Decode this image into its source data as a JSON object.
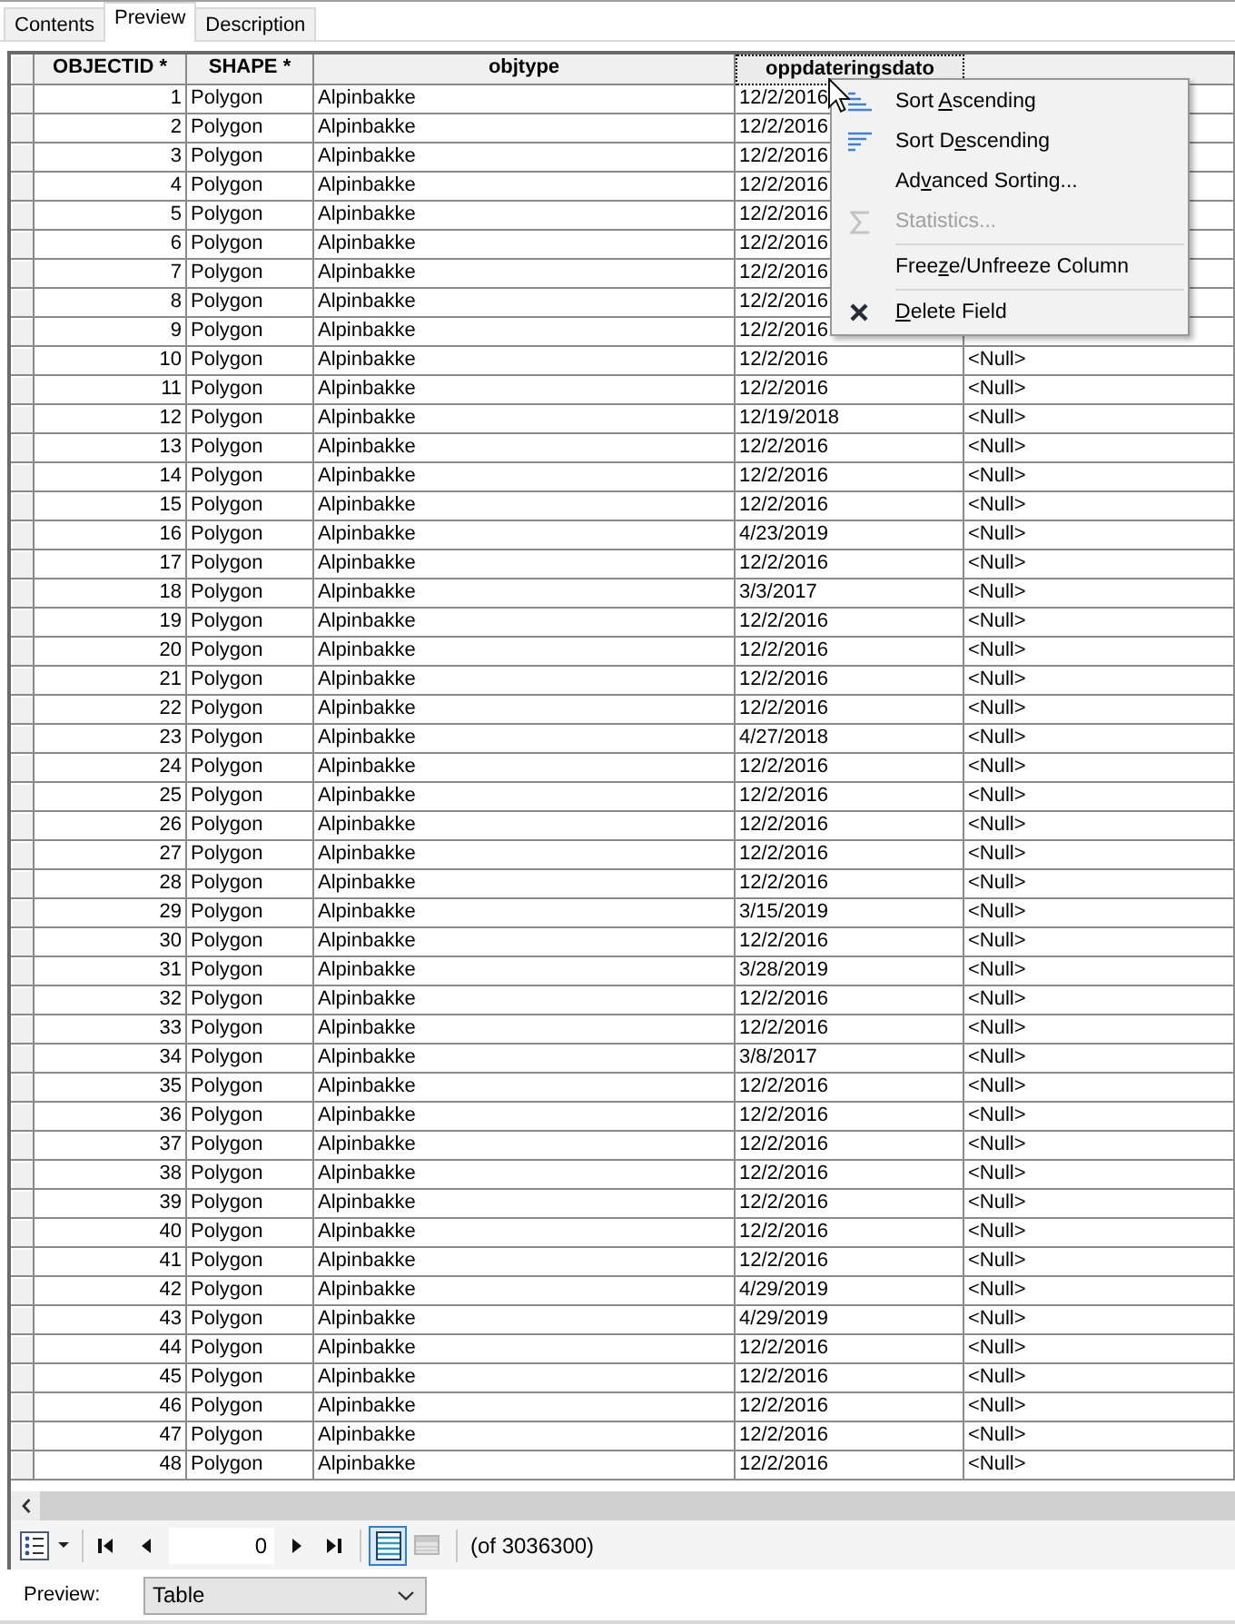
{
  "tabs": [
    {
      "label": "Contents",
      "selected": false
    },
    {
      "label": "Preview",
      "selected": true
    },
    {
      "label": "Description",
      "selected": false
    }
  ],
  "table": {
    "columns": [
      {
        "label": "OBJECTID *",
        "selected": false
      },
      {
        "label": "SHAPE *",
        "selected": false
      },
      {
        "label": "objtype",
        "selected": false
      },
      {
        "label": "oppdateringsdato",
        "selected": true
      },
      {
        "selected": false
      }
    ],
    "rows": [
      {
        "cells": [
          "1",
          "Polygon",
          "Alpinbakke",
          "12/2/2016"
        ]
      },
      {
        "cells": [
          "2",
          "Polygon",
          "Alpinbakke",
          "12/2/2016"
        ]
      },
      {
        "cells": [
          "3",
          "Polygon",
          "Alpinbakke",
          "12/2/2016"
        ]
      },
      {
        "cells": [
          "4",
          "Polygon",
          "Alpinbakke",
          "12/2/2016"
        ]
      },
      {
        "cells": [
          "5",
          "Polygon",
          "Alpinbakke",
          "12/2/2016"
        ]
      },
      {
        "cells": [
          "6",
          "Polygon",
          "Alpinbakke",
          "12/2/2016"
        ]
      },
      {
        "cells": [
          "7",
          "Polygon",
          "Alpinbakke",
          "12/2/2016"
        ]
      },
      {
        "cells": [
          "8",
          "Polygon",
          "Alpinbakke",
          "12/2/2016"
        ]
      },
      {
        "cells": [
          "9",
          "Polygon",
          "Alpinbakke",
          "12/2/2016"
        ]
      },
      {
        "cells": [
          "10",
          "Polygon",
          "Alpinbakke",
          "12/2/2016",
          "<Null>"
        ]
      },
      {
        "cells": [
          "11",
          "Polygon",
          "Alpinbakke",
          "12/2/2016",
          "<Null>"
        ]
      },
      {
        "cells": [
          "12",
          "Polygon",
          "Alpinbakke",
          "12/19/2018",
          "<Null>"
        ]
      },
      {
        "cells": [
          "13",
          "Polygon",
          "Alpinbakke",
          "12/2/2016",
          "<Null>"
        ]
      },
      {
        "cells": [
          "14",
          "Polygon",
          "Alpinbakke",
          "12/2/2016",
          "<Null>"
        ]
      },
      {
        "cells": [
          "15",
          "Polygon",
          "Alpinbakke",
          "12/2/2016",
          "<Null>"
        ]
      },
      {
        "cells": [
          "16",
          "Polygon",
          "Alpinbakke",
          "4/23/2019",
          "<Null>"
        ]
      },
      {
        "cells": [
          "17",
          "Polygon",
          "Alpinbakke",
          "12/2/2016",
          "<Null>"
        ]
      },
      {
        "cells": [
          "18",
          "Polygon",
          "Alpinbakke",
          "3/3/2017",
          "<Null>"
        ]
      },
      {
        "cells": [
          "19",
          "Polygon",
          "Alpinbakke",
          "12/2/2016",
          "<Null>"
        ]
      },
      {
        "cells": [
          "20",
          "Polygon",
          "Alpinbakke",
          "12/2/2016",
          "<Null>"
        ]
      },
      {
        "cells": [
          "21",
          "Polygon",
          "Alpinbakke",
          "12/2/2016",
          "<Null>"
        ]
      },
      {
        "cells": [
          "22",
          "Polygon",
          "Alpinbakke",
          "12/2/2016",
          "<Null>"
        ]
      },
      {
        "cells": [
          "23",
          "Polygon",
          "Alpinbakke",
          "4/27/2018",
          "<Null>"
        ]
      },
      {
        "cells": [
          "24",
          "Polygon",
          "Alpinbakke",
          "12/2/2016",
          "<Null>"
        ]
      },
      {
        "cells": [
          "25",
          "Polygon",
          "Alpinbakke",
          "12/2/2016",
          "<Null>"
        ]
      },
      {
        "cells": [
          "26",
          "Polygon",
          "Alpinbakke",
          "12/2/2016",
          "<Null>"
        ]
      },
      {
        "cells": [
          "27",
          "Polygon",
          "Alpinbakke",
          "12/2/2016",
          "<Null>"
        ]
      },
      {
        "cells": [
          "28",
          "Polygon",
          "Alpinbakke",
          "12/2/2016",
          "<Null>"
        ]
      },
      {
        "cells": [
          "29",
          "Polygon",
          "Alpinbakke",
          "3/15/2019",
          "<Null>"
        ]
      },
      {
        "cells": [
          "30",
          "Polygon",
          "Alpinbakke",
          "12/2/2016",
          "<Null>"
        ]
      },
      {
        "cells": [
          "31",
          "Polygon",
          "Alpinbakke",
          "3/28/2019",
          "<Null>"
        ]
      },
      {
        "cells": [
          "32",
          "Polygon",
          "Alpinbakke",
          "12/2/2016",
          "<Null>"
        ]
      },
      {
        "cells": [
          "33",
          "Polygon",
          "Alpinbakke",
          "12/2/2016",
          "<Null>"
        ]
      },
      {
        "cells": [
          "34",
          "Polygon",
          "Alpinbakke",
          "3/8/2017",
          "<Null>"
        ]
      },
      {
        "cells": [
          "35",
          "Polygon",
          "Alpinbakke",
          "12/2/2016",
          "<Null>"
        ]
      },
      {
        "cells": [
          "36",
          "Polygon",
          "Alpinbakke",
          "12/2/2016",
          "<Null>"
        ]
      },
      {
        "cells": [
          "37",
          "Polygon",
          "Alpinbakke",
          "12/2/2016",
          "<Null>"
        ]
      },
      {
        "cells": [
          "38",
          "Polygon",
          "Alpinbakke",
          "12/2/2016",
          "<Null>"
        ]
      },
      {
        "cells": [
          "39",
          "Polygon",
          "Alpinbakke",
          "12/2/2016",
          "<Null>"
        ]
      },
      {
        "cells": [
          "40",
          "Polygon",
          "Alpinbakke",
          "12/2/2016",
          "<Null>"
        ]
      },
      {
        "cells": [
          "41",
          "Polygon",
          "Alpinbakke",
          "12/2/2016",
          "<Null>"
        ]
      },
      {
        "cells": [
          "42",
          "Polygon",
          "Alpinbakke",
          "4/29/2019",
          "<Null>"
        ]
      },
      {
        "cells": [
          "43",
          "Polygon",
          "Alpinbakke",
          "4/29/2019",
          "<Null>"
        ]
      },
      {
        "cells": [
          "44",
          "Polygon",
          "Alpinbakke",
          "12/2/2016",
          "<Null>"
        ]
      },
      {
        "cells": [
          "45",
          "Polygon",
          "Alpinbakke",
          "12/2/2016",
          "<Null>"
        ]
      },
      {
        "cells": [
          "46",
          "Polygon",
          "Alpinbakke",
          "12/2/2016",
          "<Null>"
        ]
      },
      {
        "cells": [
          "47",
          "Polygon",
          "Alpinbakke",
          "12/2/2016",
          "<Null>"
        ]
      },
      {
        "cells": [
          "48",
          "Polygon",
          "Alpinbakke",
          "12/2/2016",
          "<Null>"
        ]
      }
    ]
  },
  "context_menu": {
    "items": [
      {
        "kind": "sort_ascending",
        "label_start": "Sort ",
        "access_key": "A",
        "label_end": "scending",
        "disabled": false
      },
      {
        "kind": "sort_descending",
        "label_start": "Sort D",
        "access_key": "e",
        "label_end": "scending",
        "disabled": false
      },
      {
        "kind": "command",
        "label_start": "Ad",
        "access_key": "v",
        "label_end": "anced Sorting...",
        "disabled": false
      },
      {
        "kind": "statistics",
        "label_start": "Statistics...",
        "disabled": true
      },
      {
        "kind": "separator"
      },
      {
        "kind": "command",
        "label_start": "Free",
        "access_key": "z",
        "label_end": "e/Unfreeze Column",
        "disabled": false
      },
      {
        "kind": "separator"
      },
      {
        "kind": "delete",
        "access_key": "D",
        "label_end": "elete Field",
        "disabled": false
      }
    ]
  },
  "toolbar": {
    "record_field": {
      "value": "0"
    },
    "view_buttons": [
      {
        "kind": "all_records",
        "selected": true,
        "disabled": false
      },
      {
        "kind": "selected_records",
        "selected": false,
        "disabled": true
      }
    ],
    "record_count": "(of 3036300)"
  },
  "preview": {
    "label": "Preview:",
    "value": "Table"
  }
}
